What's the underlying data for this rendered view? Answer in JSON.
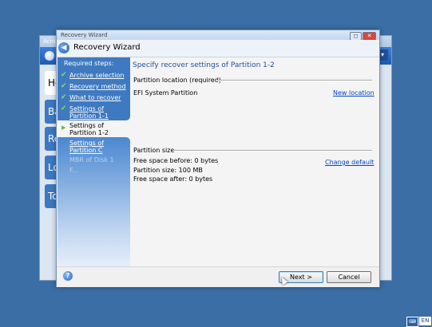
{
  "background_app": {
    "title": "Acro",
    "nav_items": [
      "Ho",
      "Ba",
      "Re",
      "Lo",
      "To"
    ]
  },
  "wizard": {
    "window_title": "Recovery Wizard",
    "header_title": "Recovery Wizard",
    "steps_heading": "Required steps:",
    "steps": [
      {
        "label": "Archive selection",
        "done": true
      },
      {
        "label": "Recovery method",
        "done": true
      },
      {
        "label": "What to recover",
        "done": true
      },
      {
        "label": "Settings of Partition 1-1",
        "done": true
      },
      {
        "label": "Settings of Partition 1-2",
        "current": true
      },
      {
        "label": "Settings of Partition C",
        "done": false
      },
      {
        "label": "MBR of Disk 1",
        "disabled": true
      },
      {
        "label": "F...",
        "disabled": true
      }
    ],
    "content_title": "Specify recover settings of Partition 1-2",
    "partition_location": {
      "label": "Partition location (required)",
      "value": "EFI System Partition",
      "link": "New location"
    },
    "partition_size": {
      "label": "Partition size",
      "free_before": "Free space before: 0 bytes",
      "size": "Partition size: 100 MB",
      "free_after": "Free space after: 0 bytes",
      "link": "Change default"
    },
    "buttons": {
      "next": "Next >",
      "cancel": "Cancel"
    }
  },
  "tray": {
    "language": "EN"
  }
}
